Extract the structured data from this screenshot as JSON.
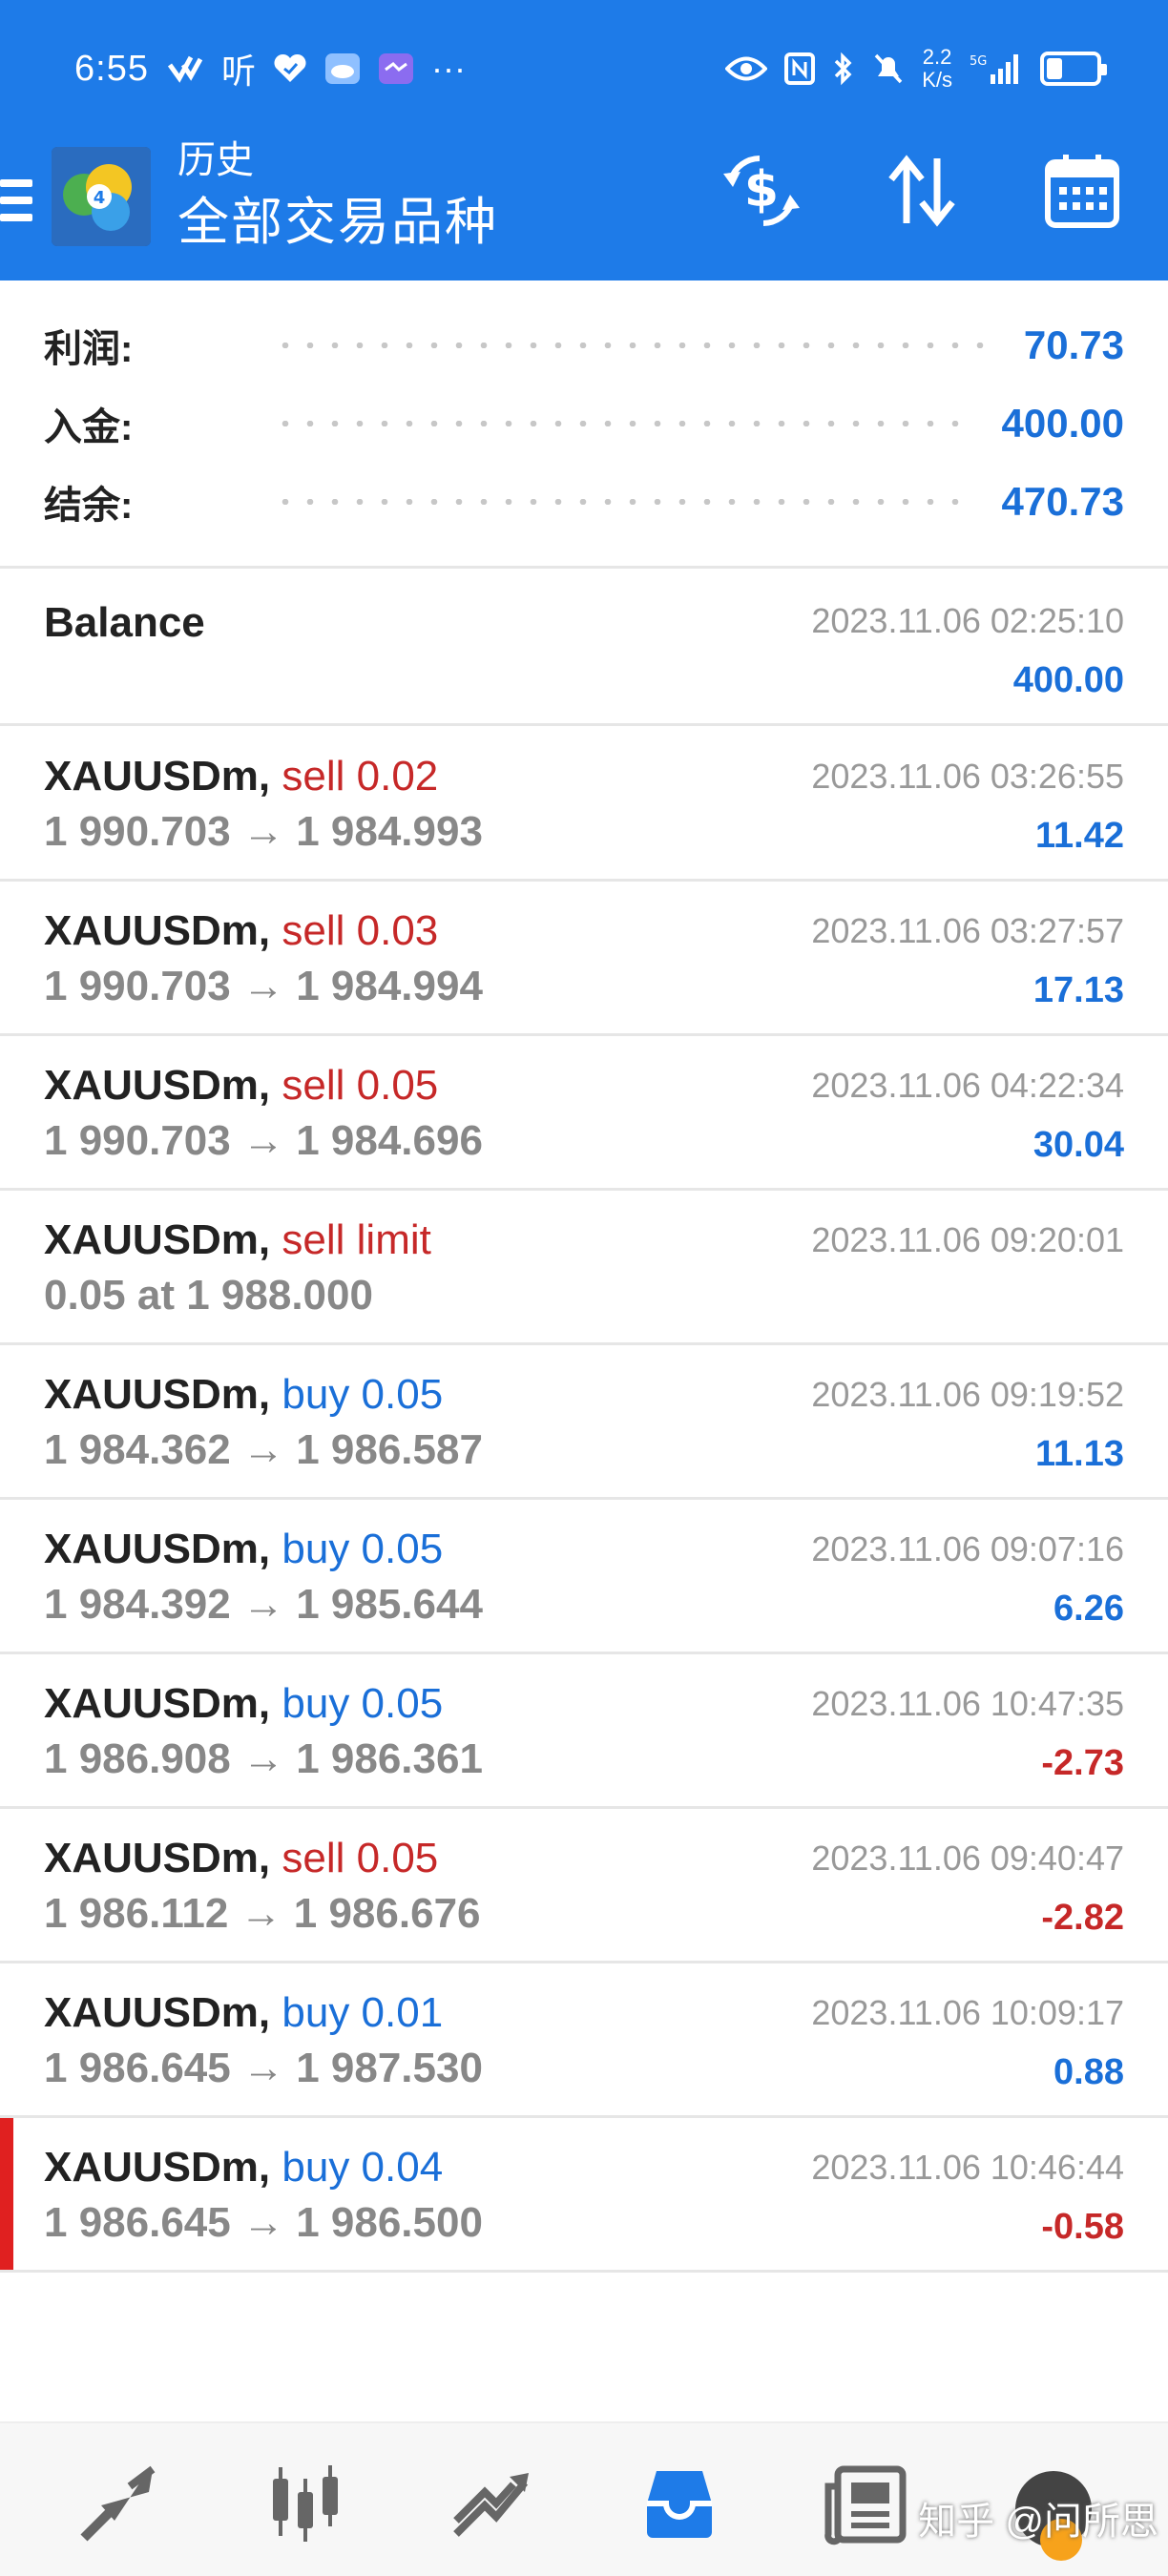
{
  "status": {
    "time": "6:55",
    "listen_glyph": "听",
    "more": "···",
    "speed_value": "2.2",
    "speed_unit": "K/s",
    "net": "5G"
  },
  "appbar": {
    "title_small": "历史",
    "title_big": "全部交易品种"
  },
  "summary": [
    {
      "label": "利润:",
      "value": "70.73"
    },
    {
      "label": "入金:",
      "value": "400.00"
    },
    {
      "label": "结余:",
      "value": "470.73"
    }
  ],
  "balance": {
    "label": "Balance",
    "time": "2023.11.06 02:25:10",
    "value": "400.00"
  },
  "trades": [
    {
      "symbol": "XAUUSDm,",
      "action": "sell 0.02",
      "side": "sell",
      "prices": "1 990.703 → 1 984.993",
      "time": "2023.11.06 03:26:55",
      "profit": "11.42",
      "profit_sign": "pos"
    },
    {
      "symbol": "XAUUSDm,",
      "action": "sell 0.03",
      "side": "sell",
      "prices": "1 990.703 → 1 984.994",
      "time": "2023.11.06 03:27:57",
      "profit": "17.13",
      "profit_sign": "pos"
    },
    {
      "symbol": "XAUUSDm,",
      "action": "sell 0.05",
      "side": "sell",
      "prices": "1 990.703 → 1 984.696",
      "time": "2023.11.06 04:22:34",
      "profit": "30.04",
      "profit_sign": "pos"
    },
    {
      "symbol": "XAUUSDm,",
      "action": "sell limit",
      "side": "sell",
      "prices": "0.05 at 1 988.000",
      "time": "2023.11.06 09:20:01",
      "profit": "",
      "profit_sign": "pos"
    },
    {
      "symbol": "XAUUSDm,",
      "action": "buy 0.05",
      "side": "buy",
      "prices": "1 984.362 → 1 986.587",
      "time": "2023.11.06 09:19:52",
      "profit": "11.13",
      "profit_sign": "pos"
    },
    {
      "symbol": "XAUUSDm,",
      "action": "buy 0.05",
      "side": "buy",
      "prices": "1 984.392 → 1 985.644",
      "time": "2023.11.06 09:07:16",
      "profit": "6.26",
      "profit_sign": "pos"
    },
    {
      "symbol": "XAUUSDm,",
      "action": "buy 0.05",
      "side": "buy",
      "prices": "1 986.908 → 1 986.361",
      "time": "2023.11.06 10:47:35",
      "profit": "-2.73",
      "profit_sign": "neg"
    },
    {
      "symbol": "XAUUSDm,",
      "action": "sell 0.05",
      "side": "sell",
      "prices": "1 986.112 → 1 986.676",
      "time": "2023.11.06 09:40:47",
      "profit": "-2.82",
      "profit_sign": "neg"
    },
    {
      "symbol": "XAUUSDm,",
      "action": "buy 0.01",
      "side": "buy",
      "prices": "1 986.645 → 1 987.530",
      "time": "2023.11.06 10:09:17",
      "profit": "0.88",
      "profit_sign": "pos"
    },
    {
      "symbol": "XAUUSDm,",
      "action": "buy 0.04",
      "side": "buy",
      "prices": "1 986.645 → 1 986.500",
      "time": "2023.11.06 10:46:44",
      "profit": "-0.58",
      "profit_sign": "neg",
      "highlighted": true
    }
  ],
  "watermark": "知乎 @问所思",
  "colors": {
    "header": "#1e7be8",
    "positive": "#1a6fd8",
    "negative": "#c62828",
    "accent": "#e02020"
  },
  "icons": {
    "appbar": [
      "menu-icon",
      "mt4-logo-icon",
      "currency-exchange-icon",
      "sort-icon",
      "calendar-icon"
    ],
    "bottomnav": [
      "quotes-icon",
      "chart-candles-icon",
      "trade-icon",
      "history-icon",
      "news-icon",
      "messages-icon"
    ]
  }
}
